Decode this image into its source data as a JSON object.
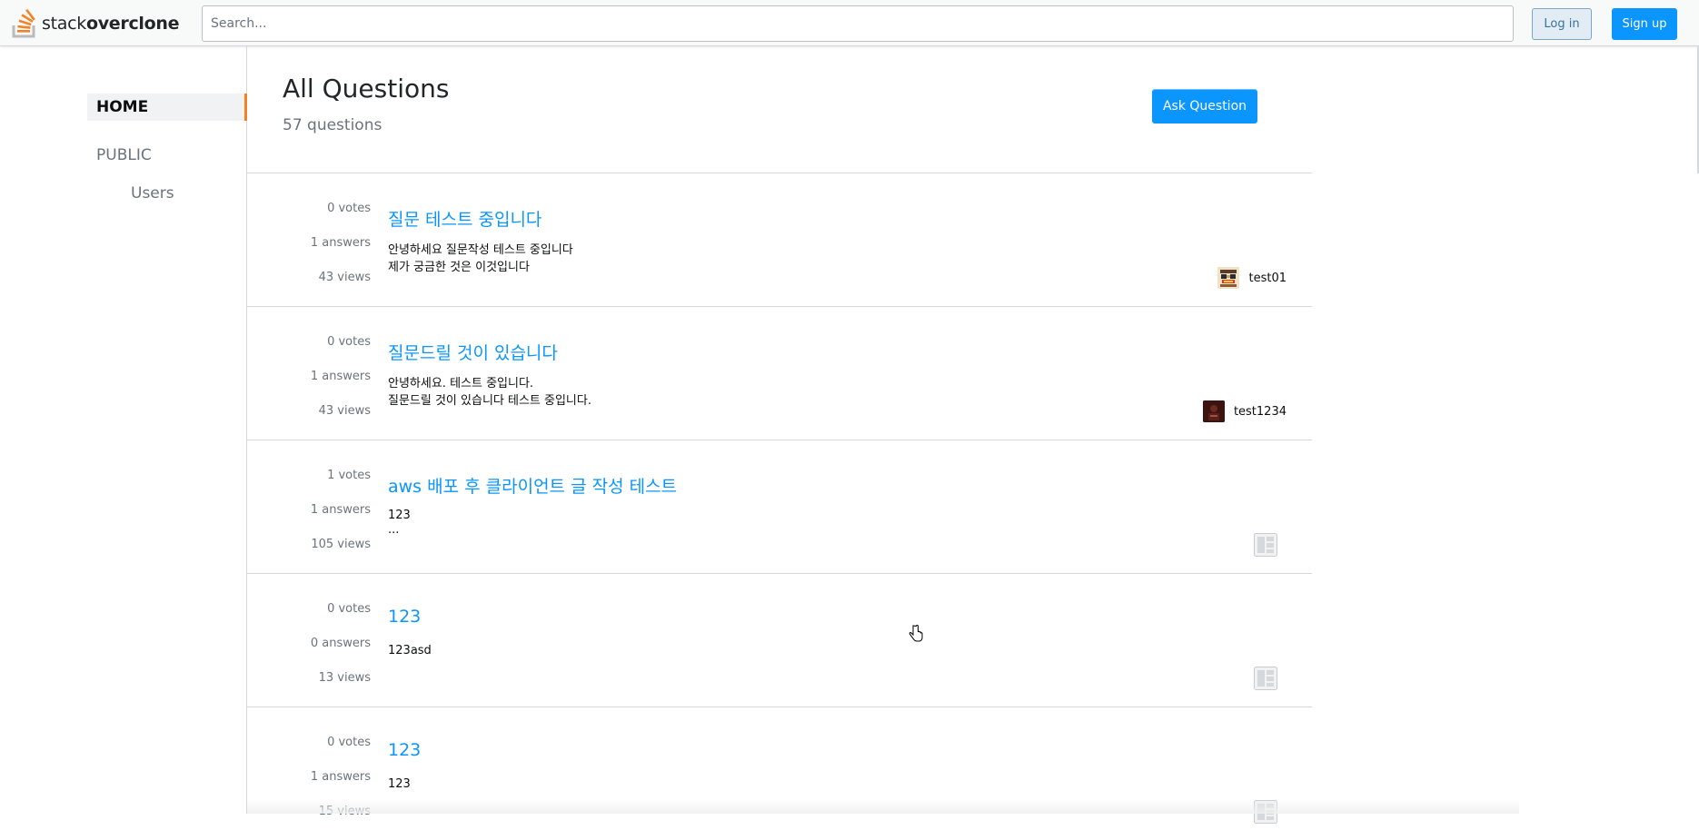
{
  "header": {
    "logo_text_light": "stack",
    "logo_text_bold": "overclone",
    "search_placeholder": "Search...",
    "login_label": "Log in",
    "signup_label": "Sign up"
  },
  "sidebar": {
    "home_label": "HOME",
    "public_label": "PUBLIC",
    "users_label": "Users"
  },
  "main": {
    "title": "All Questions",
    "count": "57 questions",
    "ask_label": "Ask Question",
    "questions": [
      {
        "votes": "0 votes",
        "answers": "1 answers",
        "views": "43 views",
        "title": "질문 테스트 중입니다",
        "body": [
          "안녕하세요 질문작성 테스트 중입니다",
          "제가 궁금한 것은 이것입니다"
        ],
        "author": "test01",
        "avatar": "pixel-avatar-icon"
      },
      {
        "votes": "0 votes",
        "answers": "1 answers",
        "views": "43 views",
        "title": "질문드릴 것이 있습니다",
        "body": [
          "안녕하세요. 테스트 중입니다.",
          "질문드릴 것이 있습니다 테스트 중입니다."
        ],
        "author": "test1234",
        "avatar": "dark-photo-avatar-icon"
      },
      {
        "votes": "1 votes",
        "answers": "1 answers",
        "views": "105 views",
        "title": "aws 배포 후 클라이언트 글 작성 테스트",
        "body": [
          "123",
          "..."
        ],
        "author": "",
        "avatar": "default-avatar-icon"
      },
      {
        "votes": "0 votes",
        "answers": "0 answers",
        "views": "13 views",
        "title": "123",
        "body": [
          "123asd"
        ],
        "author": "",
        "avatar": "default-avatar-icon"
      },
      {
        "votes": "0 votes",
        "answers": "1 answers",
        "views": "15 views",
        "title": "123",
        "body": [
          "123"
        ],
        "author": "",
        "avatar": "default-avatar-icon"
      }
    ]
  },
  "colors": {
    "accent": "#0a95ff",
    "nav_indicator": "#f48225",
    "muted_text": "#6a737c",
    "border": "#d6d9dc"
  }
}
